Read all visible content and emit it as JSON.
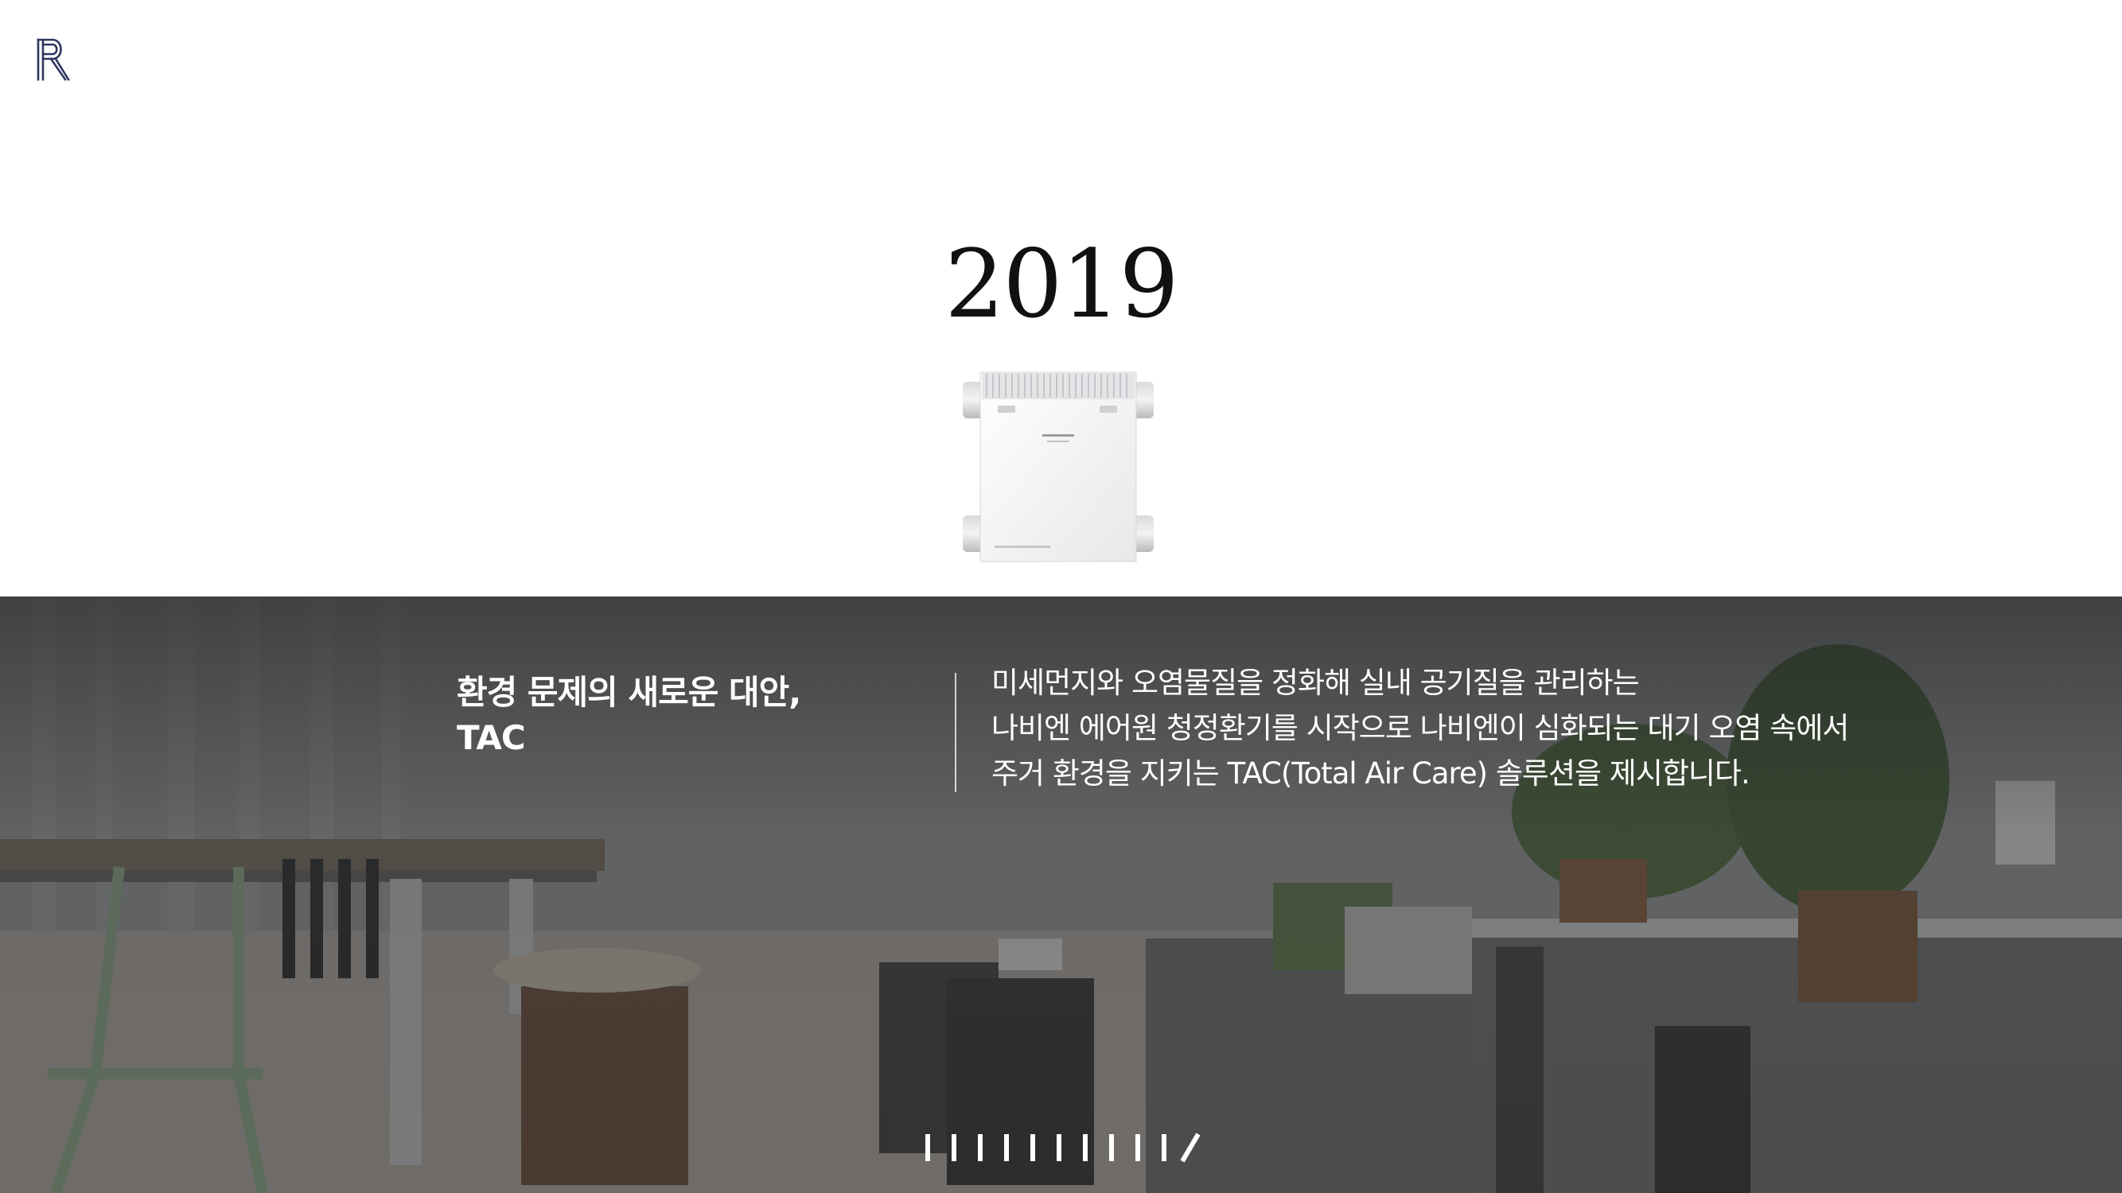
{
  "brand": {
    "logo_icon": "navien-r-logo-icon",
    "logo_color": "#2e3560"
  },
  "main": {
    "year": "2019",
    "product_icon": "ventilation-unit-product-image"
  },
  "hero": {
    "overlay_color": "#2a2c2e",
    "headline": [
      "환경 문제의 새로운 대안,",
      "TAC"
    ],
    "description": [
      "미세먼지와 오염물질을 정화해 실내 공기질을 관리하는",
      "나비엔 에어원 청정환기를 시작으로 나비엔이 심화되는 대기 오염 속에서",
      "주거 환경을 지키는 TAC(Total Air Care) 솔루션을 제시합니다."
    ]
  },
  "timeline": {
    "ticks": 11,
    "active_index": 10,
    "tick_color": "#ffffff"
  }
}
